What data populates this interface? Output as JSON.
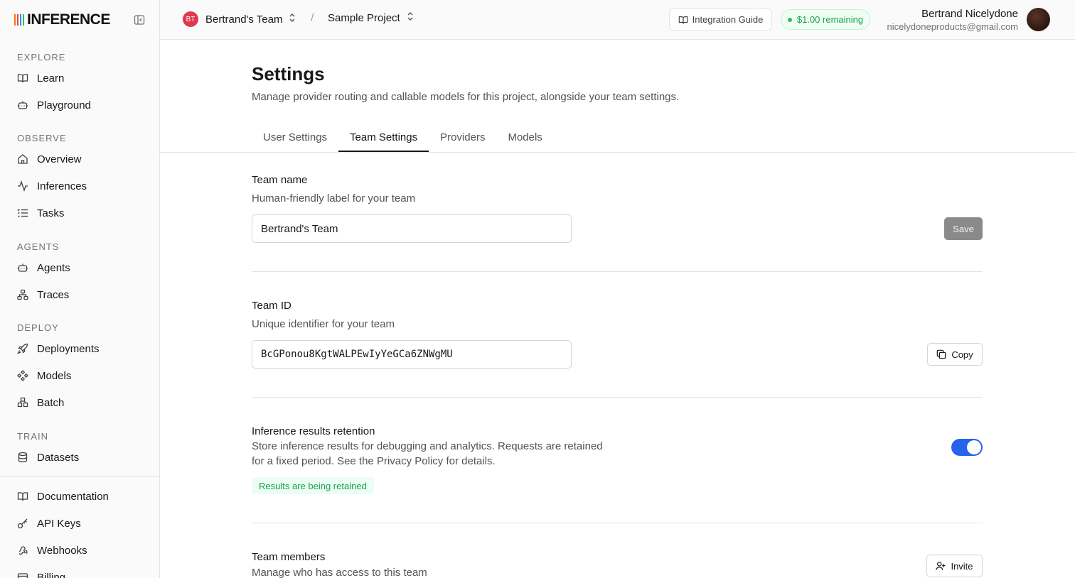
{
  "brand": {
    "name": "INFERENCE",
    "bar_colors": [
      "#f97316",
      "#ef4444",
      "#3b82f6",
      "#22c55e"
    ]
  },
  "sidebar": {
    "sections": [
      {
        "label": "EXPLORE",
        "items": [
          {
            "label": "Learn",
            "icon": "book-icon"
          },
          {
            "label": "Playground",
            "icon": "robot-icon"
          }
        ]
      },
      {
        "label": "OBSERVE",
        "items": [
          {
            "label": "Overview",
            "icon": "home-icon"
          },
          {
            "label": "Inferences",
            "icon": "activity-icon"
          },
          {
            "label": "Tasks",
            "icon": "list-icon"
          }
        ]
      },
      {
        "label": "AGENTS",
        "items": [
          {
            "label": "Agents",
            "icon": "robot-icon"
          },
          {
            "label": "Traces",
            "icon": "workflow-icon"
          }
        ]
      },
      {
        "label": "DEPLOY",
        "items": [
          {
            "label": "Deployments",
            "icon": "rocket-icon"
          },
          {
            "label": "Models",
            "icon": "components-icon"
          },
          {
            "label": "Batch",
            "icon": "boxes-icon"
          }
        ]
      },
      {
        "label": "TRAIN",
        "items": [
          {
            "label": "Datasets",
            "icon": "database-icon"
          }
        ]
      }
    ],
    "bottom_items": [
      {
        "label": "Documentation",
        "icon": "book-icon"
      },
      {
        "label": "API Keys",
        "icon": "key-icon"
      },
      {
        "label": "Webhooks",
        "icon": "webhook-icon"
      },
      {
        "label": "Billing",
        "icon": "card-icon"
      }
    ]
  },
  "topbar": {
    "team_initials": "BT",
    "team_name": "Bertrand's Team",
    "separator": "/",
    "project_name": "Sample Project",
    "integration_guide": "Integration Guide",
    "credits": "$1.00 remaining",
    "user_name": "Bertrand Nicelydone",
    "user_email": "nicelydoneproducts@gmail.com"
  },
  "page": {
    "title": "Settings",
    "subtitle": "Manage provider routing and callable models for this project, alongside your team settings.",
    "tabs": [
      {
        "label": "User Settings",
        "active": false
      },
      {
        "label": "Team Settings",
        "active": true
      },
      {
        "label": "Providers",
        "active": false
      },
      {
        "label": "Models",
        "active": false
      }
    ]
  },
  "team_name_section": {
    "title": "Team name",
    "description": "Human-friendly label for your team",
    "value": "Bertrand's Team",
    "save_label": "Save"
  },
  "team_id_section": {
    "title": "Team ID",
    "description": "Unique identifier for your team",
    "value": "BcGPonou8KgtWALPEwIyYeGCa6ZNWgMU",
    "copy_label": "Copy"
  },
  "retention_section": {
    "title": "Inference results retention",
    "description_line1": "Store inference results for debugging and analytics. Requests are retained",
    "description_line2": "for a fixed period. See the Privacy Policy for details.",
    "enabled": true,
    "status": "Results are being retained"
  },
  "members_section": {
    "title": "Team members",
    "description": "Manage who has access to this team",
    "invite_label": "Invite"
  }
}
